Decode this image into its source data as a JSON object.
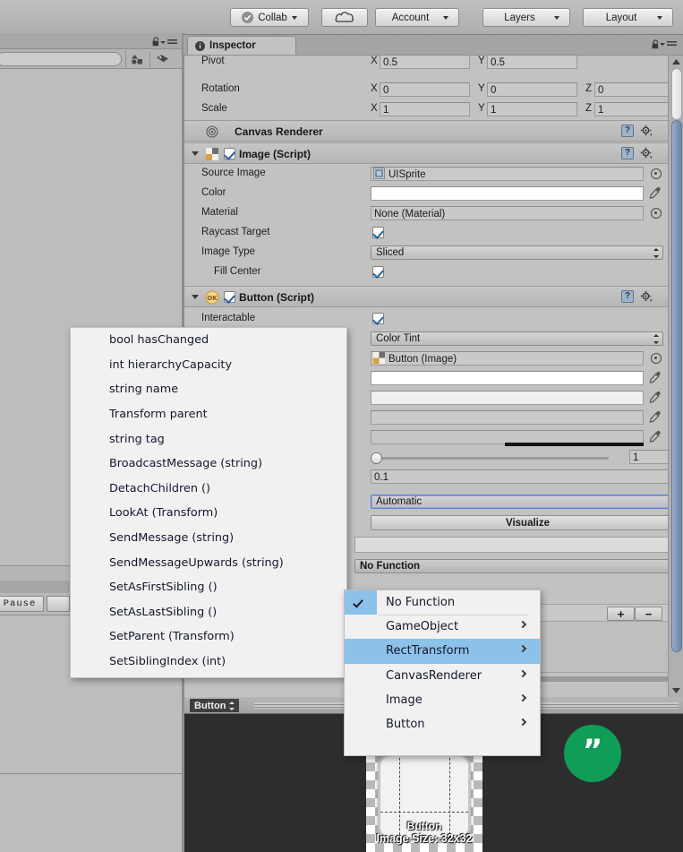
{
  "toolbar": {
    "collab": "Collab",
    "cloud_icon": "cloud-icon",
    "account": "Account",
    "layers": "Layers",
    "layout": "Layout"
  },
  "inspector": {
    "tab_label": "Inspector",
    "lock_icon": "lock-icon",
    "menu_icon": "hamburger-icon",
    "transform": {
      "pivot": {
        "label": "Pivot",
        "x_axis": "X",
        "x": "0.5",
        "y_axis": "Y",
        "y": "0.5"
      },
      "rotation": {
        "label": "Rotation",
        "x_axis": "X",
        "x": "0",
        "y_axis": "Y",
        "y": "0",
        "z_axis": "Z",
        "z": "0"
      },
      "scale": {
        "label": "Scale",
        "x_axis": "X",
        "x": "1",
        "y_axis": "Y",
        "y": "1",
        "z_axis": "Z",
        "z": "1"
      }
    },
    "canvas_renderer": {
      "title": "Canvas Renderer"
    },
    "image_script": {
      "title": "Image (Script)",
      "enabled": true,
      "source_image_label": "Source Image",
      "source_image_value": "UISprite",
      "color_label": "Color",
      "color_value": "#ffffff",
      "material_label": "Material",
      "material_value": "None (Material)",
      "raycast_label": "Raycast Target",
      "raycast_checked": true,
      "image_type_label": "Image Type",
      "image_type_value": "Sliced",
      "fill_center_label": "Fill Center",
      "fill_center_checked": true
    },
    "button_script": {
      "title": "Button (Script)",
      "enabled": true,
      "interactable_label": "Interactable",
      "interactable_checked": true,
      "transition_value": "Color Tint",
      "target_graphic_value": "Button (Image)",
      "normal_color": "#ffffff",
      "highlighted_color": "#efefef",
      "pressed_color": "#cacaca",
      "disabled_color": "#c7c7c7",
      "fade_slider_value": "1",
      "fade_duration": "0.1",
      "navigation_value": "Automatic",
      "visualize_label": "Visualize",
      "on_click_function": "No Function",
      "add_button": "+",
      "remove_button": "−"
    }
  },
  "context_menu": {
    "items": [
      "bool hasChanged",
      "int hierarchyCapacity",
      "string name",
      "Transform parent",
      "string tag",
      "BroadcastMessage (string)",
      "DetachChildren ()",
      "LookAt (Transform)",
      "SendMessage (string)",
      "SendMessageUpwards (string)",
      "SetAsFirstSibling ()",
      "SetAsLastSibling ()",
      "SetParent (Transform)",
      "SetSiblingIndex (int)"
    ]
  },
  "function_menu": {
    "items": [
      {
        "label": "No Function",
        "checked": true,
        "submenu": false,
        "selected": false
      },
      {
        "label": "GameObject",
        "checked": false,
        "submenu": true,
        "selected": false
      },
      {
        "label": "RectTransform",
        "checked": false,
        "submenu": true,
        "selected": true
      },
      {
        "label": "CanvasRenderer",
        "checked": false,
        "submenu": true,
        "selected": false
      },
      {
        "label": "Image",
        "checked": false,
        "submenu": true,
        "selected": false
      },
      {
        "label": "Button",
        "checked": false,
        "submenu": true,
        "selected": false
      }
    ],
    "highlight_color": "#8cc1ea"
  },
  "left_panel": {
    "search_placeholder": "",
    "layers_icon": "shapes-icon",
    "tag_icon": "tag-icon",
    "pause_label": "Pause",
    "step_icon": "step-icon"
  },
  "game_view": {
    "tag_label": "Button",
    "sprite_caption": "Button",
    "sprite_size": "Image Size: 32x32",
    "hangouts_icon": "hangouts-quote-icon",
    "hangouts_color": "#0f9d58"
  }
}
